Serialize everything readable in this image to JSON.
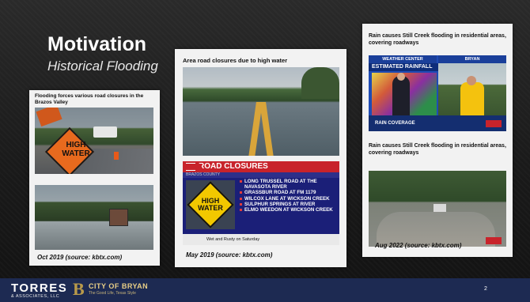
{
  "slide": {
    "title": "Motivation",
    "subtitle": "Historical Flooding",
    "page_number": "2"
  },
  "panels": [
    {
      "caption": "Flooding forces various road closures in the Brazos Valley",
      "source": "Oct 2019 (source: kbtx.com)",
      "sign_text": "HIGH WATER"
    },
    {
      "caption": "Area road closures due to high water",
      "source": "May 2019 (source: kbtx.com)",
      "graphic": {
        "header": "ROAD CLOSURES",
        "subheader": "BRAZOS COUNTY",
        "sign_text": "HIGH WATER",
        "items": [
          "LONG TRUSSEL ROAD AT THE NAVASOTA RIVER",
          "GRASSBUR ROAD AT FM 1179",
          "WILCOX LANE AT WICKSON CREEK",
          "SULPHUR SPRINGS AT RIVER",
          "ELMO WEEDON AT WICKSON CREEK"
        ],
        "ticker": "Wet and Rusty on Saturday"
      }
    },
    {
      "caption_top": "Rain causes Still Creek flooding in residential areas, covering roadways",
      "caption_bottom": "Rain causes Still Creek flooding in residential areas, covering roadways",
      "source": "Aug 2022 (source: kbtx.com)",
      "weather": {
        "left_label": "WEATHER CENTER",
        "right_label": "BRYAN",
        "title": "ESTIMATED RAINFALL",
        "bottom": "RAIN COVERAGE"
      }
    }
  ],
  "footer": {
    "company": "TORRES",
    "company_sub": "& ASSOCIATES, LLC",
    "city": "CITY OF BRYAN",
    "city_sub": "The Good Life, Texas Style"
  },
  "colors": {
    "footer_bg": "#1d2a52",
    "kbtx_red": "#c8232b",
    "kbtx_blue": "#1b1f78"
  }
}
